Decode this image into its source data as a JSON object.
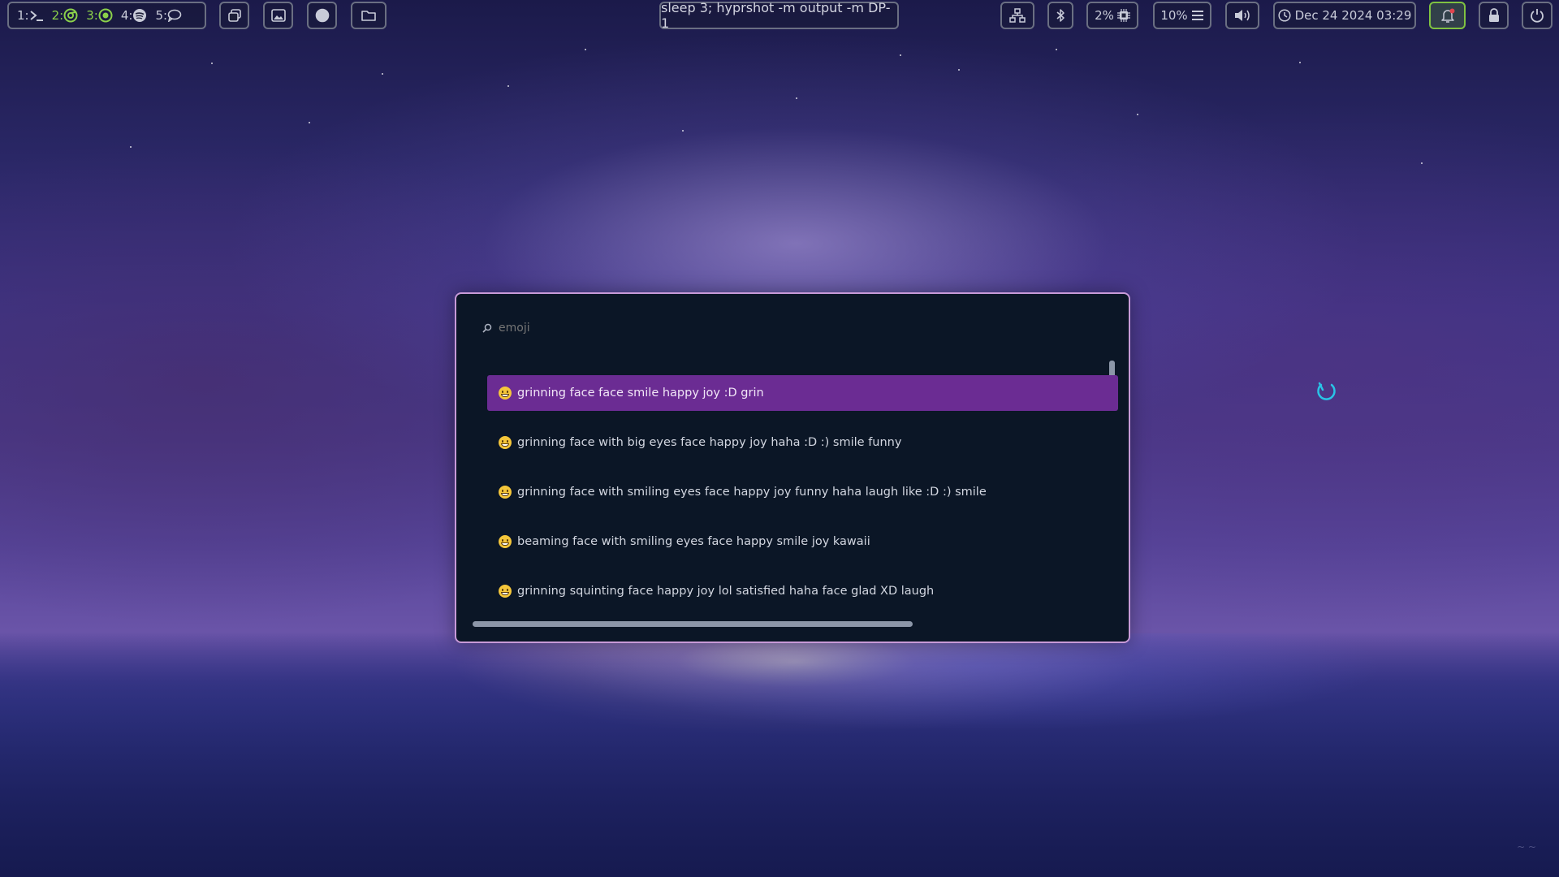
{
  "topbar": {
    "workspaces": [
      {
        "num": "1:",
        "icon": "terminal-icon",
        "active": false
      },
      {
        "num": "2:",
        "icon": "chrome-icon",
        "active": true
      },
      {
        "num": "3:",
        "icon": "radio-icon",
        "active": true
      },
      {
        "num": "4:",
        "icon": "spotify-icon",
        "active": false
      },
      {
        "num": "5:",
        "icon": "chat-icon",
        "active": false
      }
    ],
    "window_title": "sleep 3; hyprshot -m output -m DP-1",
    "cpu_label": "2%",
    "memory_label": "10%",
    "clock": "Dec 24 2024 03:29",
    "colors": {
      "active_workspace": "#8bd14a",
      "notification": "#7fc241"
    }
  },
  "launcher": {
    "search_placeholder": "emoji",
    "accent": "#6b2c93",
    "border": "#c89ad8",
    "entries": [
      {
        "label": "grinning face face smile happy joy :D grin",
        "selected": true
      },
      {
        "label": "grinning face with big eyes face happy joy haha :D :) smile funny",
        "selected": false
      },
      {
        "label": "grinning face with smiling eyes face happy joy funny haha laugh like :D :) smile",
        "selected": false
      },
      {
        "label": "beaming face with smiling eyes face happy smile joy kawaii",
        "selected": false
      },
      {
        "label": "grinning squinting face happy joy lol satisfied haha face glad XD laugh",
        "selected": false
      }
    ]
  }
}
